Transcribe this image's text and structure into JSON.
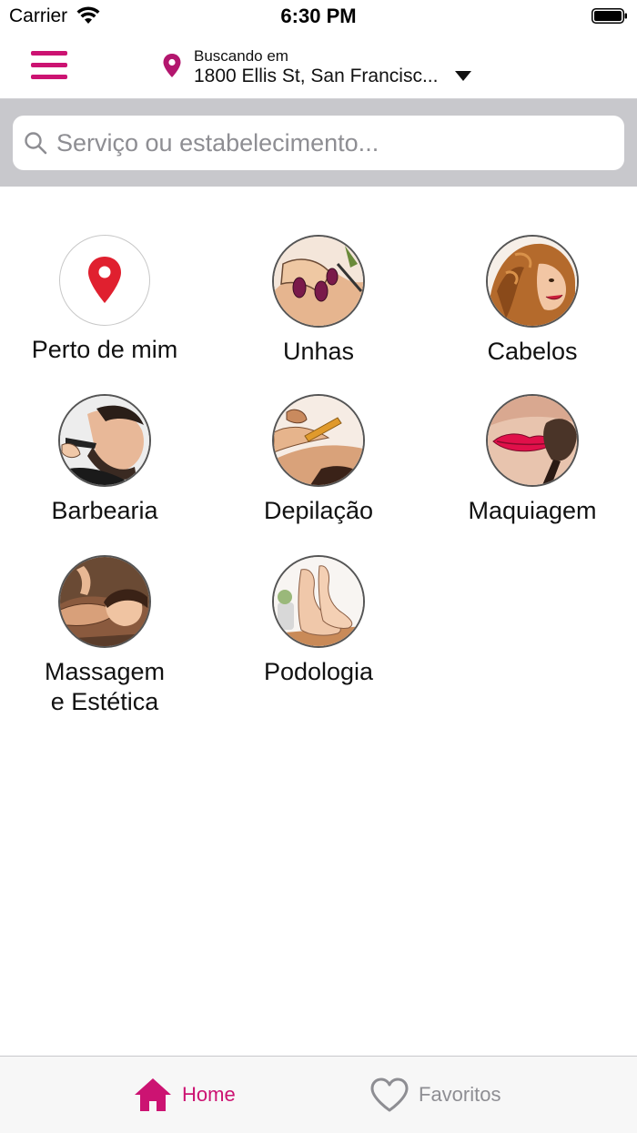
{
  "status_bar": {
    "carrier": "Carrier",
    "time": "6:30 PM"
  },
  "header": {
    "menu_icon": "hamburger-icon",
    "location_icon": "location-pin-icon",
    "location_caption": "Buscando em",
    "location_address": "1800 Ellis St, San Francisc...",
    "dropdown_icon": "caret-down-icon"
  },
  "search": {
    "icon": "search-icon",
    "placeholder": "Serviço ou estabelecimento...",
    "value": ""
  },
  "categories": [
    {
      "label": "Perto de mim",
      "icon": "map-pin-icon"
    },
    {
      "label": "Unhas",
      "icon": "nails-photo"
    },
    {
      "label": "Cabelos",
      "icon": "hair-photo"
    },
    {
      "label": "Barbearia",
      "icon": "barber-photo"
    },
    {
      "label": "Depilação",
      "icon": "waxing-photo"
    },
    {
      "label": "Maquiagem",
      "icon": "makeup-photo"
    },
    {
      "label": "Massagem\ne Estética",
      "icon": "massage-photo"
    },
    {
      "label": "Podologia",
      "icon": "feet-photo"
    }
  ],
  "tab_bar": {
    "home_label": "Home",
    "favorites_label": "Favoritos"
  },
  "colors": {
    "accent": "#cc1372",
    "search_band": "#c8c8cc",
    "pin_red": "#e0202f",
    "inactive_tab": "#8e8e93"
  }
}
